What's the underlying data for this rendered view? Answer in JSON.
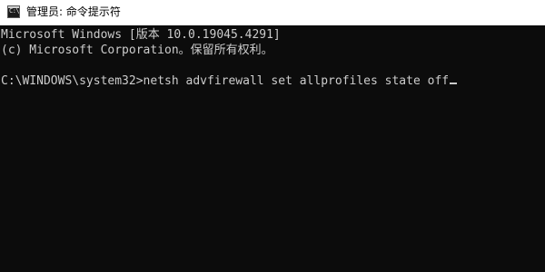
{
  "window": {
    "title": "管理员: 命令提示符",
    "icon": "cmd-console-icon",
    "icon_glyph": "C:\\"
  },
  "console": {
    "lines": [
      "Microsoft Windows [版本 10.0.19045.4291]",
      "(c) Microsoft Corporation。保留所有权利。"
    ],
    "prompt": "C:\\WINDOWS\\system32>",
    "command": "netsh advfirewall set allprofiles state off",
    "colors": {
      "background": "#0c0c0c",
      "text": "#cccccc",
      "titlebar": "#ffffff"
    }
  }
}
